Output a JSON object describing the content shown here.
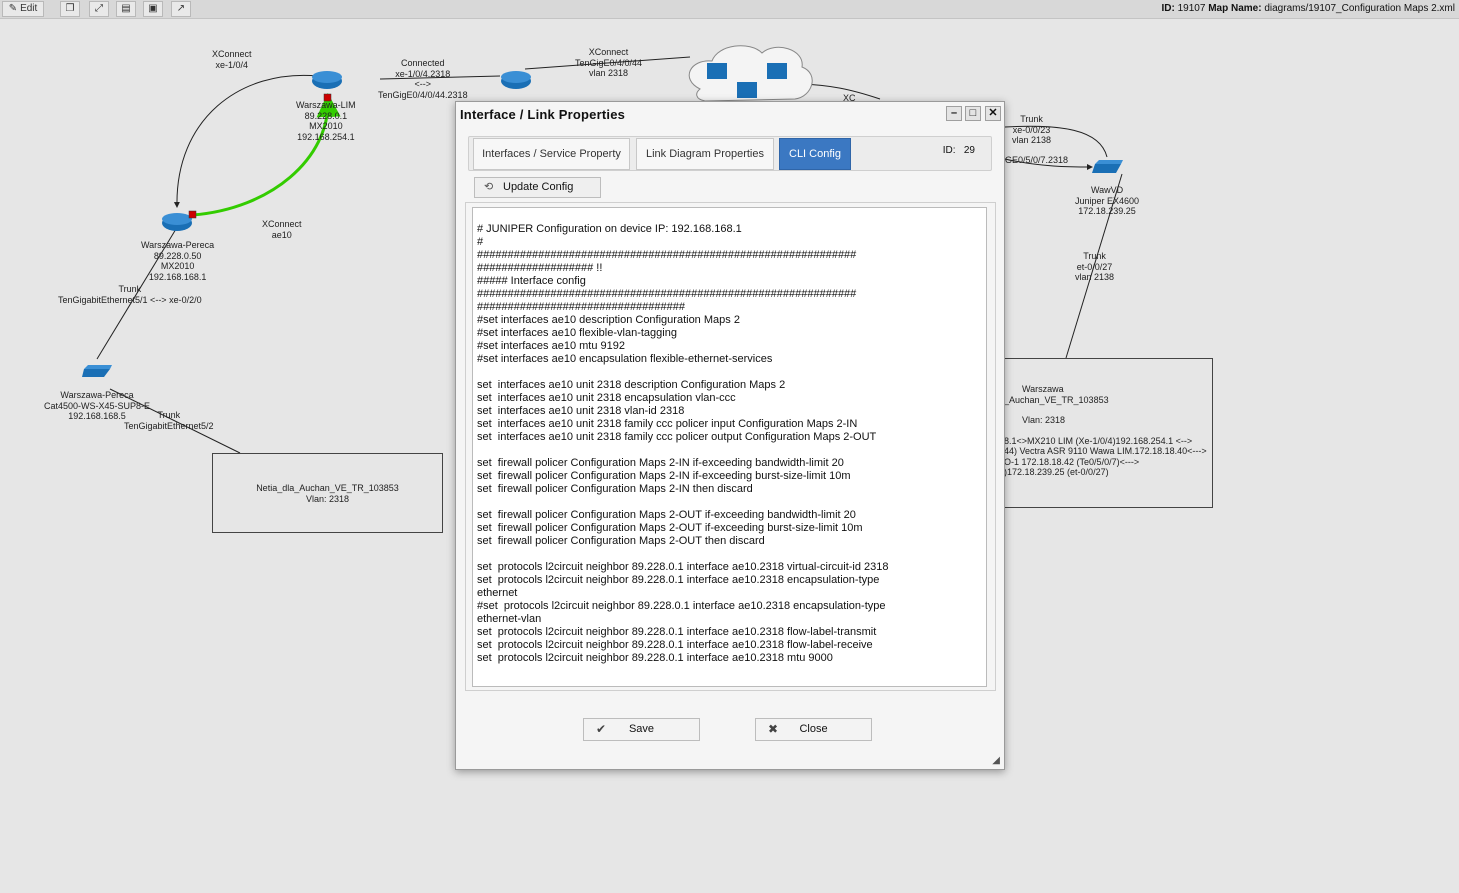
{
  "toolbar": {
    "edit_label": "Edit",
    "icons": [
      "clone-icon",
      "fullscreen-icon",
      "page-icon",
      "save-disk-icon",
      "external-link-icon"
    ]
  },
  "header": {
    "id_label": "ID:",
    "id_value": "19107",
    "map_name_label": "Map Name:",
    "map_name_value": "diagrams/19107_Configuration Maps 2.xml"
  },
  "map": {
    "labels": {
      "xconnect_top": [
        "XConnect",
        "xe-1/0/4"
      ],
      "connected": [
        "Connected",
        "xe-1/0/4.2318",
        "<-->",
        "TenGigE0/4/0/44.2318"
      ],
      "xconnect_right": [
        "XConnect",
        "TenGigE0/4/0/44",
        "vlan 2318"
      ],
      "lim_node": [
        "Warszawa-LIM",
        "89.228.0.1",
        "MX2010",
        "192.168.254.1"
      ],
      "pereca_node": [
        "Warszawa-Pereca",
        "89.228.0.50",
        "MX2010",
        "192.168.168.1"
      ],
      "xconnect_ae10": [
        "XConnect",
        "ae10"
      ],
      "trunk_left": [
        "Trunk",
        "TenGigabitEthernet5/1 <--> xe-0/2/0"
      ],
      "switch_node": [
        "Warszawa-Pereca",
        "Cat4500-WS-X45-SUP8-E",
        "192.168.168.5"
      ],
      "trunk_bottom": [
        "Trunk",
        "TenGigabitEthernet5/2"
      ],
      "trunk_right_top": [
        "Trunk",
        "xe-0/0/23",
        "vlan 2138"
      ],
      "gige_label": "GE0/5/0/7.2318",
      "wawvd_node": [
        "WawVD",
        "Juniper EX4600",
        "172.18.239.25"
      ],
      "trunk_right": [
        "Trunk",
        "et-0/0/27",
        "vlan 2138"
      ],
      "xc_partial": "XC"
    },
    "box_left": {
      "lines": [
        "Netia_dla_Auchan_VE_TR_103853",
        "Vlan: 2318"
      ]
    },
    "box_right": {
      "lines": [
        "Warszawa",
        "_Auchan_VE_TR_103853",
        "",
        "Vlan: 2318",
        "",
        "8.1<>MX210 LIM (Xe-1/0/4)192.168.254.1 <-->",
        "44) Vectra ASR 9110 Wawa LIM.172.18.18.40<--->",
        "O-1 172.18.18.42 (Te0/5/0/7)<--->",
        ")172.18.239.25 (et-0/0/27)"
      ]
    }
  },
  "dialog": {
    "title": "Interface / Link Properties",
    "tabs": [
      "Interfaces / Service Property",
      "Link Diagram Properties",
      "CLI Config"
    ],
    "id_label": "ID:",
    "id_value": "29",
    "update_label": "Update Config",
    "config_text": "# JUNIPER Configuration on device IP: 192.168.168.1\n#\n##############################################################\n################### !!\n##### Interface config\n##############################################################\n##################################\n#set interfaces ae10 description Configuration Maps 2\n#set interfaces ae10 flexible-vlan-tagging\n#set interfaces ae10 mtu 9192\n#set interfaces ae10 encapsulation flexible-ethernet-services\n\nset  interfaces ae10 unit 2318 description Configuration Maps 2\nset  interfaces ae10 unit 2318 encapsulation vlan-ccc\nset  interfaces ae10 unit 2318 vlan-id 2318\nset  interfaces ae10 unit 2318 family ccc policer input Configuration Maps 2-IN\nset  interfaces ae10 unit 2318 family ccc policer output Configuration Maps 2-OUT\n\nset  firewall policer Configuration Maps 2-IN if-exceeding bandwidth-limit 20\nset  firewall policer Configuration Maps 2-IN if-exceeding burst-size-limit 10m\nset  firewall policer Configuration Maps 2-IN then discard\n\nset  firewall policer Configuration Maps 2-OUT if-exceeding bandwidth-limit 20\nset  firewall policer Configuration Maps 2-OUT if-exceeding burst-size-limit 10m\nset  firewall policer Configuration Maps 2-OUT then discard\n\nset  protocols l2circuit neighbor 89.228.0.1 interface ae10.2318 virtual-circuit-id 2318\nset  protocols l2circuit neighbor 89.228.0.1 interface ae10.2318 encapsulation-type\nethernet\n#set  protocols l2circuit neighbor 89.228.0.1 interface ae10.2318 encapsulation-type\nethernet-vlan\nset  protocols l2circuit neighbor 89.228.0.1 interface ae10.2318 flow-label-transmit\nset  protocols l2circuit neighbor 89.228.0.1 interface ae10.2318 flow-label-receive\nset  protocols l2circuit neighbor 89.228.0.1 interface ae10.2318 mtu 9000",
    "save_label": "Save",
    "close_label": "Close"
  },
  "colors": {
    "active_tab": "#3b78c2",
    "link_green": "#33cc00",
    "router_blue": "#1a6fb5",
    "marker_red": "#cc0000"
  }
}
